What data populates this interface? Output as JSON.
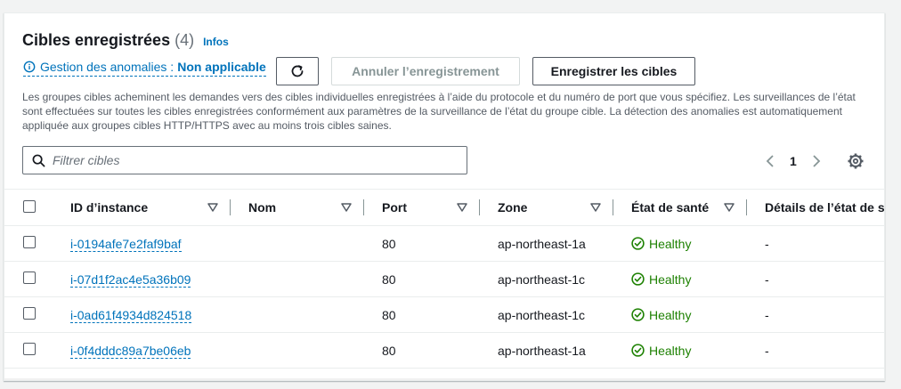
{
  "header": {
    "title": "Cibles enregistrées",
    "count": "(4)",
    "info_link": "Infos"
  },
  "anomaly": {
    "label": "Gestion des anomalies :",
    "value": "Non applicable"
  },
  "actions": {
    "refresh_icon": "refresh-icon",
    "cancel_label": "Annuler l’enregistrement",
    "register_label": "Enregistrer les cibles"
  },
  "description": "Les groupes cibles acheminent les demandes vers des cibles individuelles enregistrées à l’aide du protocole et du numéro de port que vous spécifiez. Les surveillances de l’état sont effectuées sur toutes les cibles enregistrées conformément aux paramètres de la surveillance de l’état du groupe cible. La détection des anomalies est automatiquement appliquée aux groupes cibles HTTP/HTTPS avec au moins trois cibles saines.",
  "filter": {
    "placeholder": "Filtrer cibles"
  },
  "pagination": {
    "current_page": "1"
  },
  "table": {
    "columns": [
      "ID d’instance",
      "Nom",
      "Port",
      "Zone",
      "État de santé",
      "Détails de l’état de santé"
    ],
    "rows": [
      {
        "id": "i-0194afe7e2faf9baf",
        "name": "",
        "port": "80",
        "zone": "ap-northeast-1a",
        "health": "Healthy",
        "details": "-"
      },
      {
        "id": "i-07d1f2ac4e5a36b09",
        "name": "",
        "port": "80",
        "zone": "ap-northeast-1c",
        "health": "Healthy",
        "details": "-"
      },
      {
        "id": "i-0ad61f4934d824518",
        "name": "",
        "port": "80",
        "zone": "ap-northeast-1c",
        "health": "Healthy",
        "details": "-"
      },
      {
        "id": "i-0f4dddc89a7be06eb",
        "name": "",
        "port": "80",
        "zone": "ap-northeast-1a",
        "health": "Healthy",
        "details": "-"
      }
    ]
  },
  "colors": {
    "link": "#0073bb",
    "healthy": "#1d8102",
    "text": "#16191f",
    "muted": "#545b64"
  }
}
